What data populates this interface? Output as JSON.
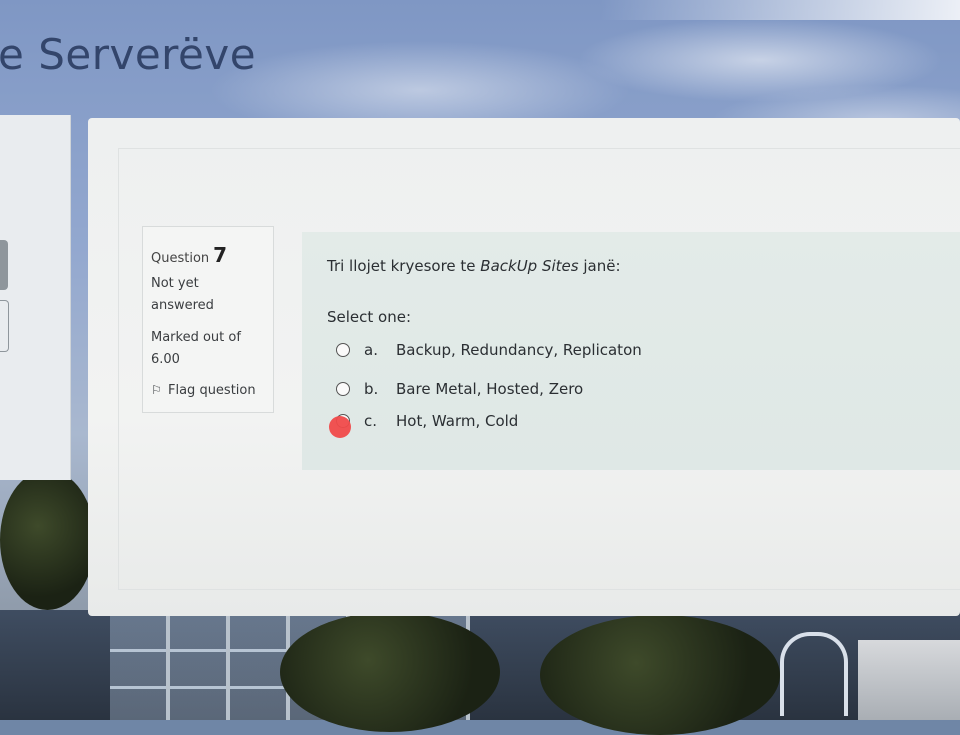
{
  "course": {
    "title": "e Serverëve"
  },
  "question": {
    "label_word": "Question",
    "number": "7",
    "state": "Not yet answered",
    "marks": "Marked out of 6.00",
    "flag_label": "Flag question",
    "text_before": "Tri llojet kryesore te ",
    "text_italic": "BackUp Sites",
    "text_after": " janë:",
    "prompt": "Select one:",
    "options": [
      {
        "letter": "a.",
        "text": "Backup, Redundancy, Replicaton",
        "selected": false
      },
      {
        "letter": "b.",
        "text": "Bare Metal, Hosted, Zero",
        "selected": false
      },
      {
        "letter": "c.",
        "text": "Hot, Warm, Cold",
        "selected": false
      }
    ]
  },
  "icons": {
    "flag": "flag-icon"
  },
  "colors": {
    "title": "#33456b",
    "content_bg": "#e3ebe8",
    "cursor": "#f04a4a"
  }
}
